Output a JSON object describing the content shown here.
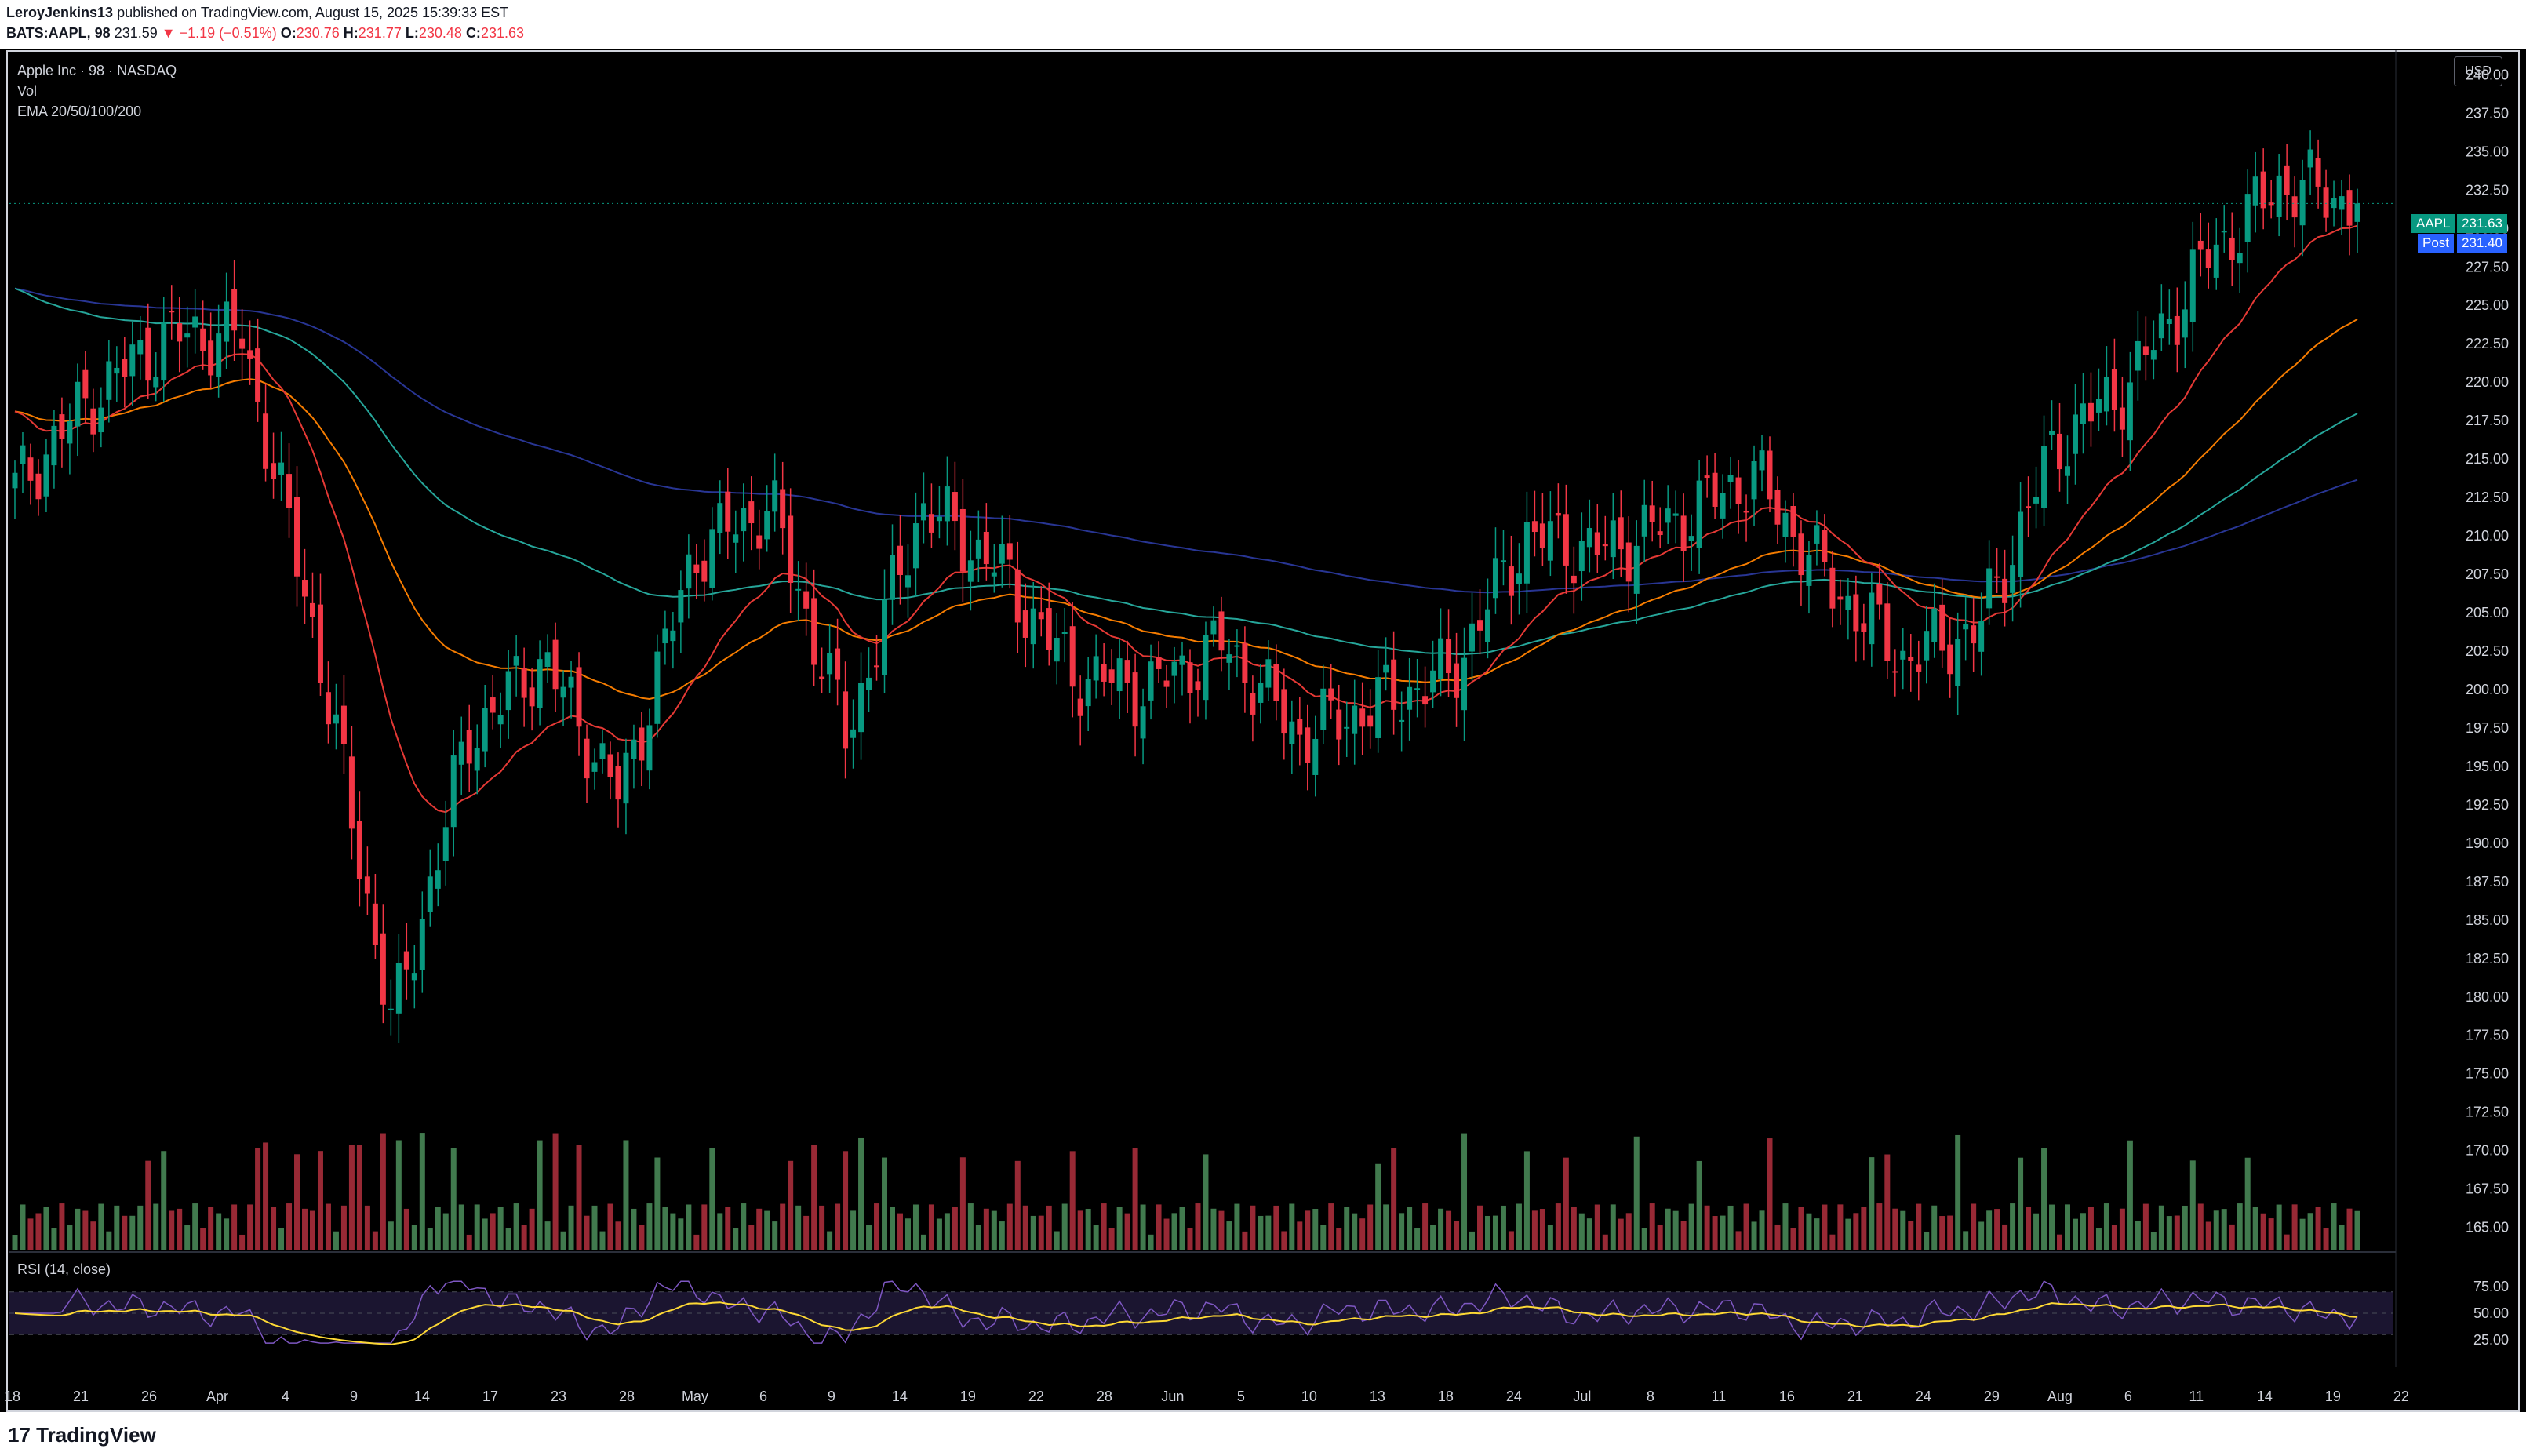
{
  "header": {
    "author": "LeroyJenkins13",
    "published_text": "published on TradingView.com, August 15, 2025 15:39:33 EST",
    "symbol_line": "BATS:AAPL, 98",
    "price": "231.59",
    "change": "▼ −1.19 (−0.51%)",
    "o_label": "O:",
    "o_value": "230.76",
    "h_label": "H:",
    "h_value": "231.77",
    "l_label": "L:",
    "l_value": "230.48",
    "c_label": "C:",
    "c_value": "231.63"
  },
  "legend": {
    "title": "Apple Inc · 98 · NASDAQ",
    "vol": "Vol",
    "ema": "EMA 20/50/100/200",
    "rsi": "RSI (14, close)"
  },
  "currency": "USD",
  "tags": {
    "aapl_label": "AAPL",
    "aapl_value": "231.63",
    "post_label": "Post",
    "post_value": "231.40"
  },
  "footer": {
    "logo": "17 TradingView"
  },
  "colors": {
    "up": "#4c8f5c",
    "down": "#b3303e",
    "ema20": "#e53935",
    "ema50": "#f57c00",
    "ema100": "#26a69a",
    "ema200": "#283593",
    "rsi": "#7e57c2",
    "rsi_ma": "#fdd835"
  },
  "chart_data": {
    "type": "candlestick",
    "y_axis_ticks": [
      "240.00",
      "237.50",
      "235.00",
      "232.50",
      "230.00",
      "227.50",
      "225.00",
      "222.50",
      "220.00",
      "217.50",
      "215.00",
      "212.50",
      "210.00",
      "207.50",
      "205.00",
      "202.50",
      "200.00",
      "197.50",
      "195.00",
      "192.50",
      "190.00",
      "187.50",
      "185.00",
      "182.50",
      "180.00",
      "177.50",
      "175.00",
      "172.50",
      "170.00",
      "167.50",
      "165.00"
    ],
    "ylim": [
      163.5,
      241.5
    ],
    "x_axis_ticks": [
      "18",
      "21",
      "26",
      "Apr",
      "4",
      "9",
      "14",
      "17",
      "23",
      "28",
      "May",
      "6",
      "9",
      "14",
      "19",
      "22",
      "28",
      "Jun",
      "5",
      "10",
      "13",
      "18",
      "24",
      "Jul",
      "8",
      "11",
      "16",
      "21",
      "24",
      "29",
      "Aug",
      "6",
      "11",
      "14",
      "19",
      "22"
    ],
    "rsi_axis_ticks": [
      "75.00",
      "50.00",
      "25.00"
    ],
    "rsi_levels": [
      70,
      30
    ],
    "current_price": 231.63,
    "post_price": 231.4,
    "series_close_anchors": [
      {
        "date": "Mar 18",
        "close": 213
      },
      {
        "date": "Mar 21",
        "close": 219
      },
      {
        "date": "Mar 26",
        "close": 223
      },
      {
        "date": "Apr 1",
        "close": 223
      },
      {
        "date": "Apr 3",
        "close": 203
      },
      {
        "date": "Apr 8",
        "close": 178
      },
      {
        "date": "Apr 9",
        "close": 197
      },
      {
        "date": "Apr 14",
        "close": 202
      },
      {
        "date": "Apr 21",
        "close": 193
      },
      {
        "date": "Apr 28",
        "close": 209
      },
      {
        "date": "May 2",
        "close": 212
      },
      {
        "date": "May 6",
        "close": 197
      },
      {
        "date": "May 13",
        "close": 212
      },
      {
        "date": "May 19",
        "close": 208
      },
      {
        "date": "May 22",
        "close": 201
      },
      {
        "date": "May 28",
        "close": 200
      },
      {
        "date": "Jun 5",
        "close": 203
      },
      {
        "date": "Jun 13",
        "close": 197
      },
      {
        "date": "Jun 20",
        "close": 199
      },
      {
        "date": "Jun 26",
        "close": 201
      },
      {
        "date": "Jul 1",
        "close": 210
      },
      {
        "date": "Jul 7",
        "close": 209
      },
      {
        "date": "Jul 16",
        "close": 211
      },
      {
        "date": "Jul 24",
        "close": 214
      },
      {
        "date": "Jul 31",
        "close": 207
      },
      {
        "date": "Aug 1",
        "close": 202
      },
      {
        "date": "Aug 5",
        "close": 204
      },
      {
        "date": "Aug 7",
        "close": 216
      },
      {
        "date": "Aug 8",
        "close": 220
      },
      {
        "date": "Aug 11",
        "close": 228
      },
      {
        "date": "Aug 13",
        "close": 233
      },
      {
        "date": "Aug 15",
        "close": 231.63
      }
    ]
  }
}
